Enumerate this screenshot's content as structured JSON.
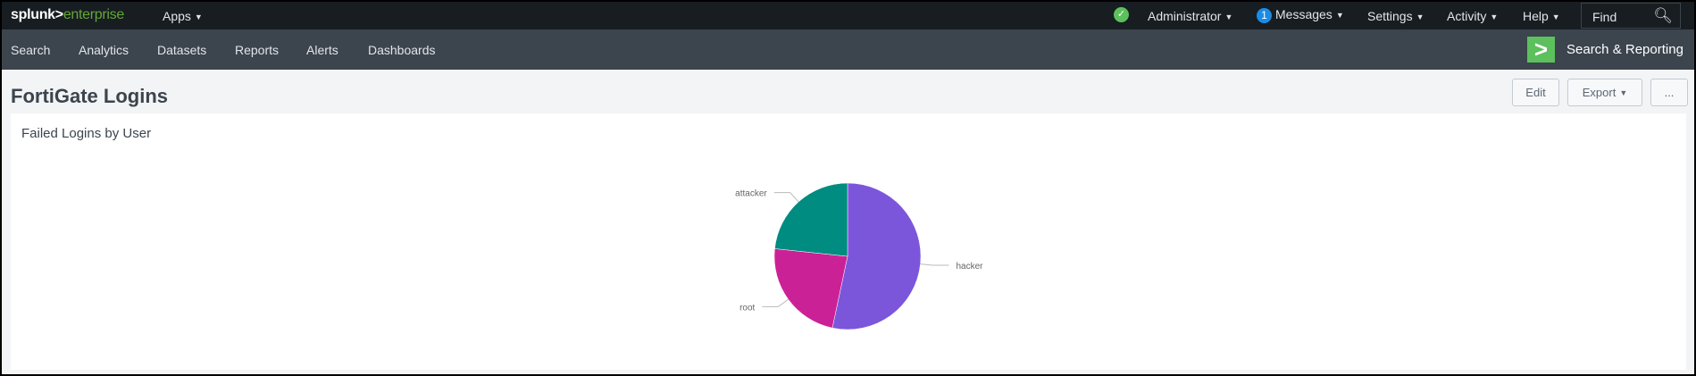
{
  "topbar": {
    "logo_main": "splunk>",
    "logo_sub": "enterprise",
    "apps": "Apps",
    "administrator": "Administrator",
    "messages_count": "1",
    "messages": "Messages",
    "settings": "Settings",
    "activity": "Activity",
    "help": "Help",
    "find_placeholder": "Find"
  },
  "nav": {
    "items": [
      "Search",
      "Analytics",
      "Datasets",
      "Reports",
      "Alerts",
      "Dashboards"
    ],
    "app_name": "Search & Reporting"
  },
  "dashboard": {
    "title": "FortiGate Logins",
    "edit": "Edit",
    "export": "Export",
    "more": "..."
  },
  "panel": {
    "title": "Failed Logins by User"
  },
  "chart_data": {
    "type": "pie",
    "title": "Failed Logins by User",
    "categories": [
      "hacker",
      "root",
      "attacker"
    ],
    "values": [
      16,
      7,
      7
    ],
    "colors": [
      "#7b56db",
      "#cb2196",
      "#008c80"
    ]
  }
}
